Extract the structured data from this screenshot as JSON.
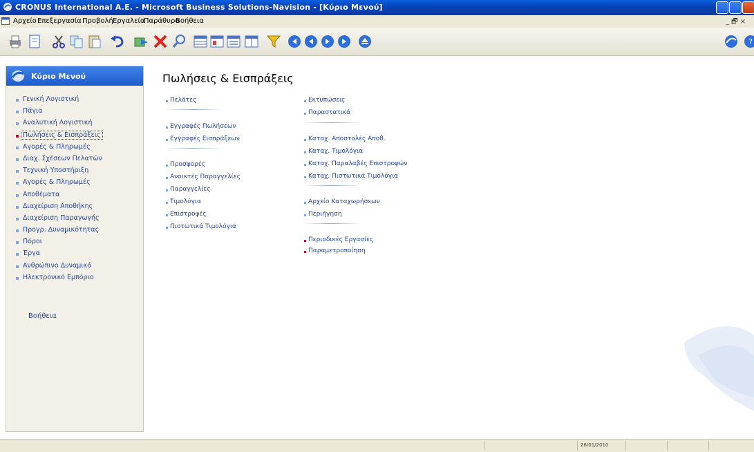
{
  "window": {
    "title": "CRONUS International A.E. - Microsoft Business Solutions-Navision - [Κύριο Μενού]"
  },
  "menu": {
    "items": [
      "Αρχείο",
      "Επεξεργασία",
      "Προβολή",
      "Εργαλεία",
      "Παράθυρο",
      "Βοήθεια"
    ],
    "mdi_controls": "_ 🗗 ×"
  },
  "toolbar": {
    "buttons": [
      "print-icon",
      "print-preview-icon",
      "cut-icon",
      "copy-icon",
      "paste-icon",
      "undo-icon",
      "insert-icon",
      "delete-icon",
      "find-icon",
      "list-icon",
      "card-icon",
      "form-icon",
      "table-icon",
      "filter-icon",
      "first-icon",
      "previous-icon",
      "next-icon",
      "last-icon",
      "eject-icon",
      "navigator-icon",
      "help-icon"
    ]
  },
  "sidebar": {
    "header": "Κύριο Μενού",
    "items": [
      {
        "label": "Γενική Λογιστική"
      },
      {
        "label": "Πάγια"
      },
      {
        "label": "Αναλυτική Λογιστική"
      },
      {
        "label": "Πωλήσεις & Εισπράξεις"
      },
      {
        "label": "Αγορές & Πληρωμές"
      },
      {
        "label": "Διαχ. Σχέσεων Πελατών"
      },
      {
        "label": "Τεχνική Υποστήριξη"
      },
      {
        "label": "Αγορές & Πληρωμές"
      },
      {
        "label": "Αποθέματα"
      },
      {
        "label": "Διαχείριση Αποθήκης"
      },
      {
        "label": "Διαχείριση Παραγωγής"
      },
      {
        "label": "Προγρ. Δυναμικότητας"
      },
      {
        "label": "Πόροι"
      },
      {
        "label": "Έργα"
      },
      {
        "label": "Ανθρώπινο Δυναμικό"
      },
      {
        "label": "Ηλεκτρονικό Εμπόριο"
      }
    ],
    "active_index": 3,
    "help": "Βοήθεια"
  },
  "main": {
    "title": "Πωλήσεις & Εισπράξεις",
    "col1": {
      "customers": "Πελάτες",
      "sales_journals": "Εγγραφές Πωλήσεων",
      "receipt_journals": "Εγγραφές Εισπράξεων",
      "quotes": "Προσφορές",
      "blanket_orders": "Ανοικτές Παραγγελίες",
      "orders": "Παραγγελίες",
      "invoices": "Τιμολόγια",
      "return_orders": "Επιστροφές",
      "credit_memos": "Πιστωτικά Τιμολόγια"
    },
    "col2": {
      "reports": "Εκτυπώσεις",
      "documents": "Παραστατικά",
      "posted_shipments": "Καταχ. Αποστολές Αποθ.",
      "posted_invoices": "Καταχ. Τιμολόγια",
      "posted_return_receipts": "Καταχ. Παραλαβές Επιστροφών",
      "posted_credit_memos": "Καταχ. Πιστωτικά Τιμολόγια",
      "archived_documents": "Αρχείο Καταχωρήσεων",
      "analysis": "Περιήγηση",
      "periodic_activities": "Περιοδικές Εργασίες",
      "setup": "Παραμετροποίηση"
    }
  },
  "status": {
    "date": "26/01/2010"
  }
}
